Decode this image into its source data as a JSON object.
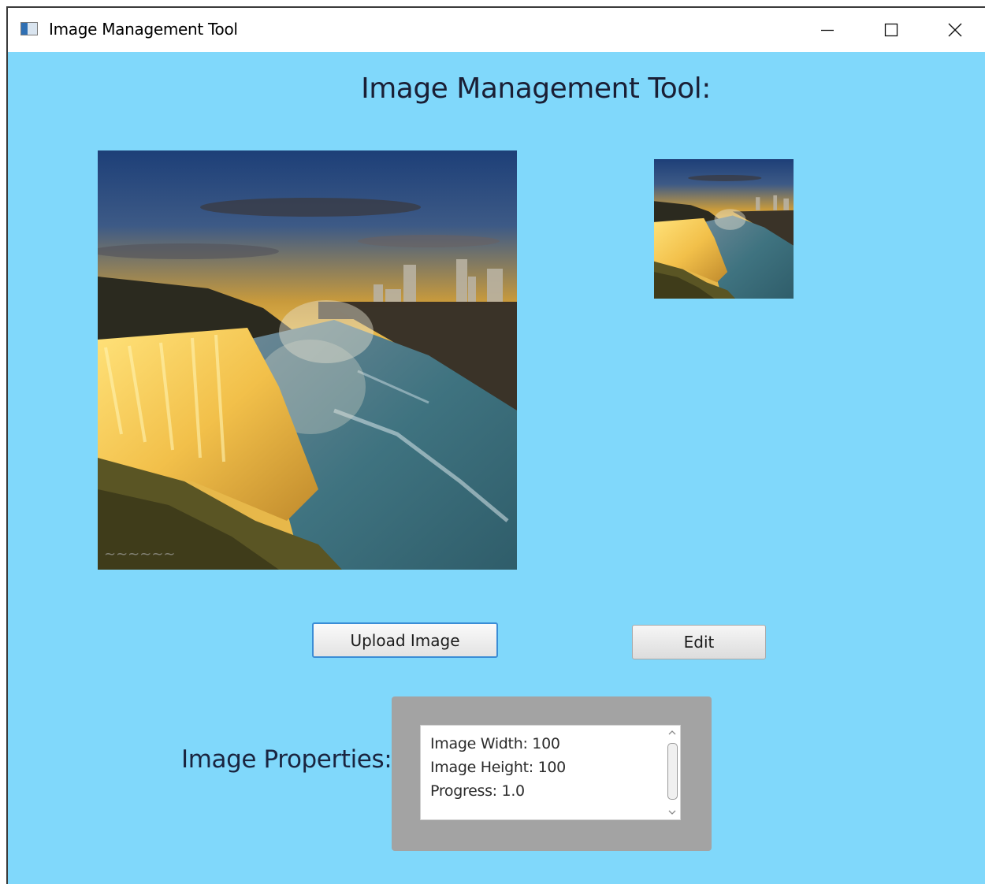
{
  "window": {
    "title": "Image Management Tool",
    "background_color": "#80d8fb",
    "controls": [
      "minimize-icon",
      "maximize-icon",
      "close-icon"
    ]
  },
  "header": {
    "title": "Image Management Tool:"
  },
  "images": {
    "main_preview": "waterfall-photo",
    "thumbnail": "waterfall-photo"
  },
  "buttons": {
    "upload_label": "Upload Image",
    "edit_label": "Edit"
  },
  "properties": {
    "label": "Image Properties:",
    "lines": [
      "Image Width: 100",
      "Image Height: 100",
      "Progress: 1.0"
    ]
  }
}
